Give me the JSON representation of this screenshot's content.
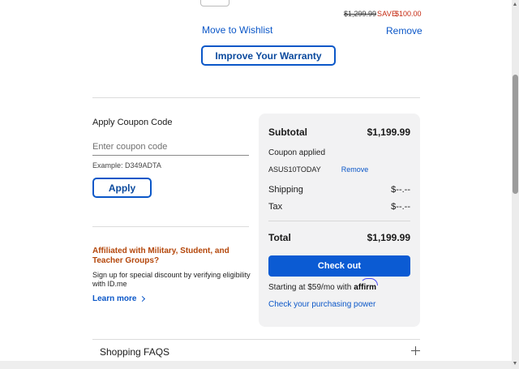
{
  "item": {
    "original_price": "$1,299.99",
    "save_label": "SAVE",
    "save_amount": "$100.00",
    "move_to_wishlist": "Move to Wishlist",
    "remove": "Remove",
    "improve_warranty": "Improve Your Warranty"
  },
  "coupon": {
    "title": "Apply Coupon Code",
    "placeholder": "Enter coupon code",
    "example": "Example: D349ADTA",
    "apply": "Apply"
  },
  "affiliation": {
    "title": "Affiliated with Military, Student, and Teacher Groups?",
    "text": "Sign up for special discount by verifying eligibility with ID.me",
    "learn_more": "Learn more"
  },
  "summary": {
    "subtotal_label": "Subtotal",
    "subtotal_value": "$1,199.99",
    "coupon_applied": "Coupon applied",
    "coupon_code": "ASUS10TODAY",
    "remove_coupon": "Remove",
    "shipping_label": "Shipping",
    "shipping_value": "$--.--",
    "tax_label": "Tax",
    "tax_value": "$--.--",
    "total_label": "Total",
    "total_value": "$1,199.99",
    "checkout": "Check out",
    "affirm_text": "Starting at $59/mo with",
    "affirm_logo": "affirm",
    "purchasing_power": "Check your purchasing power"
  },
  "faq": {
    "title": "Shopping FAQS"
  }
}
